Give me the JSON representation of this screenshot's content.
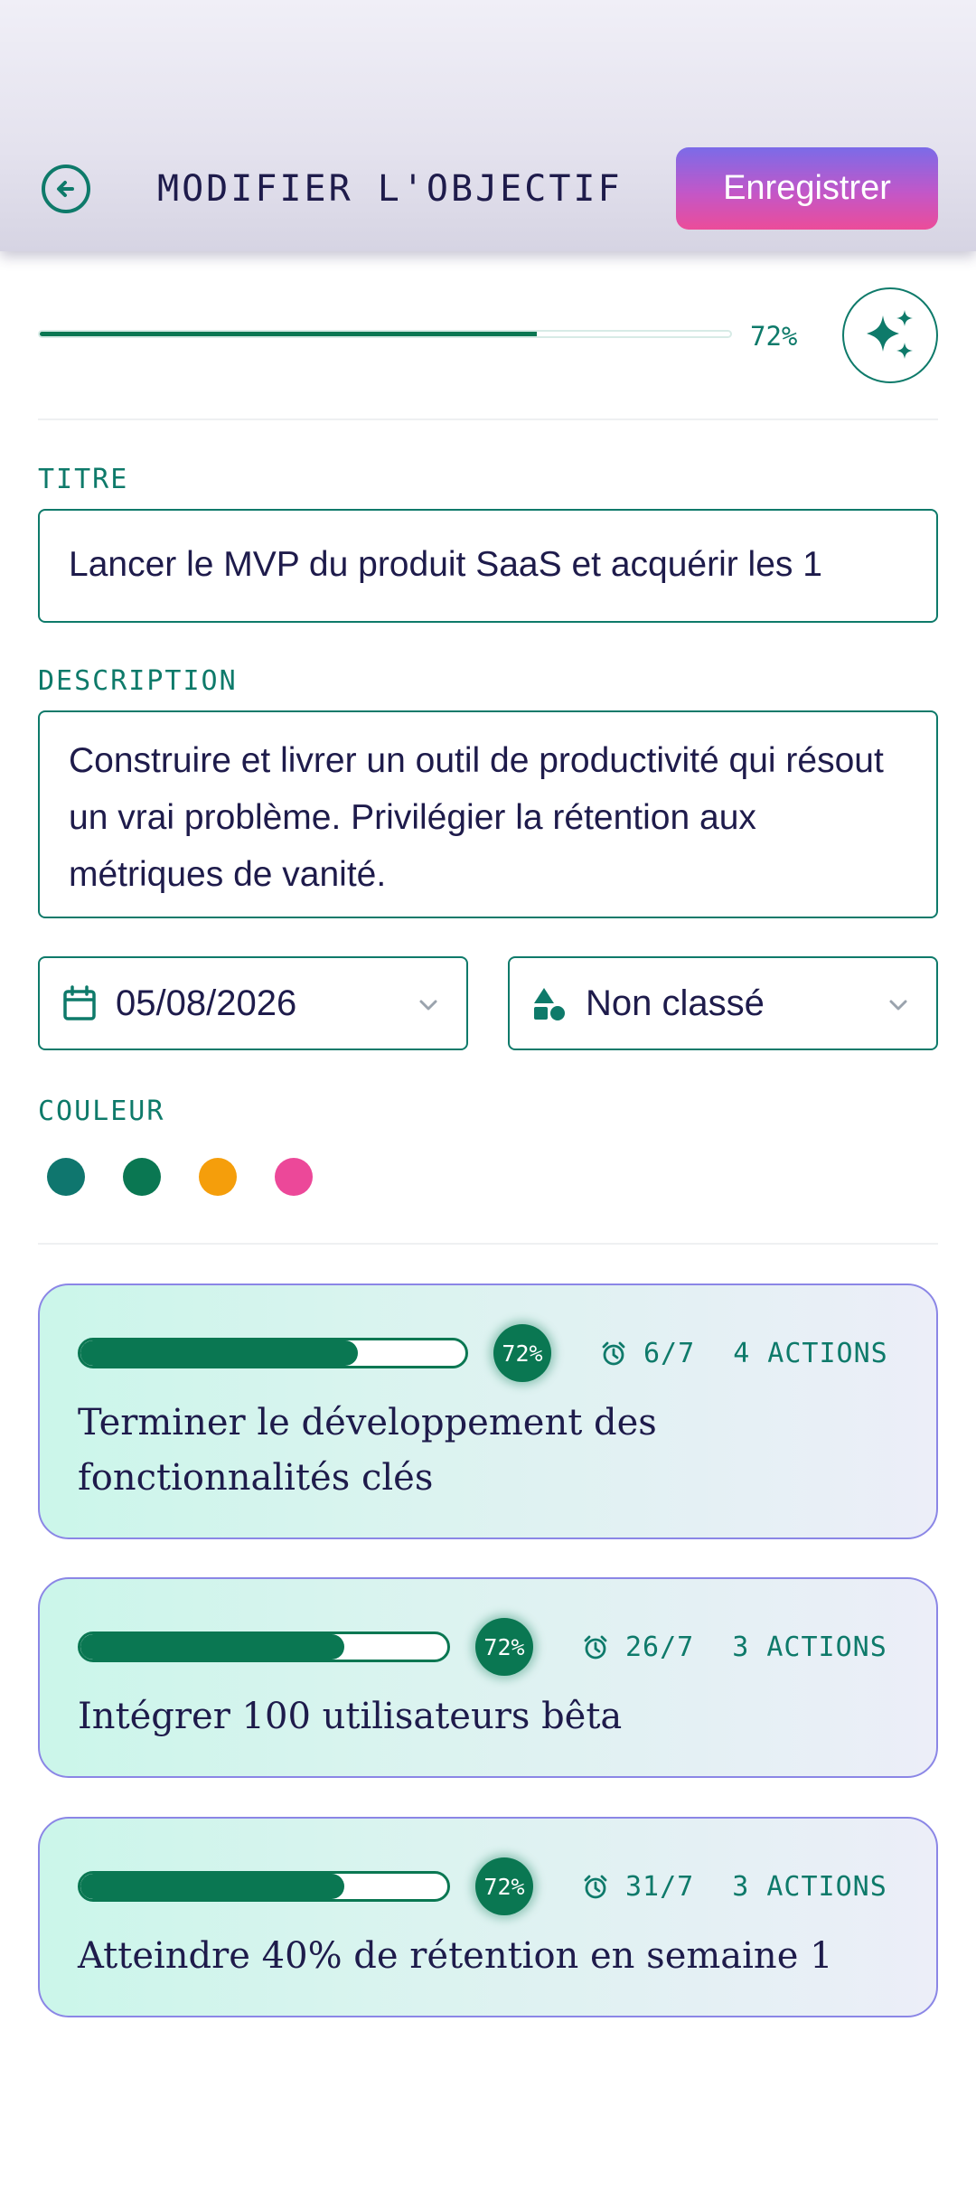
{
  "header": {
    "title": "MODIFIER L'OBJECTIF",
    "save_label": "Enregistrer"
  },
  "progress": {
    "value": 0.72,
    "label": "72%"
  },
  "form": {
    "title_label": "TITRE",
    "title_value": "Lancer le MVP du produit SaaS et acquérir les 1",
    "description_label": "DESCRIPTION",
    "description_value": "Construire et livrer un outil de productivité qui résout un vrai problème. Privilégier la rétention aux métriques de vanité.",
    "date_value": "05/08/2026",
    "category_value": "Non classé",
    "color_label": "COULEUR",
    "colors": [
      "#0f766e",
      "#0a7752",
      "#f59e0b",
      "#ec4899"
    ]
  },
  "milestones": [
    {
      "progress": 0.72,
      "badge": "72%",
      "deadline": "6/7",
      "actions": "4 ACTIONS",
      "title": "Terminer le développement des fonctionnalités clés"
    },
    {
      "progress": 0.72,
      "badge": "72%",
      "deadline": "26/7",
      "actions": "3 ACTIONS",
      "title": "Intégrer 100 utilisateurs bêta"
    },
    {
      "progress": 0.72,
      "badge": "72%",
      "deadline": "31/7",
      "actions": "3 ACTIONS",
      "title": "Atteindre 40% de rétention en semaine 1"
    }
  ],
  "icons": {
    "back": "arrow-left-circle-icon",
    "ai": "sparkles-icon",
    "calendar": "calendar-icon",
    "category": "shapes-icon",
    "chevron": "chevron-down-icon",
    "alarm": "alarm-clock-icon"
  },
  "theme": {
    "accent": "#0e7a6a",
    "progress_green": "#0a7752",
    "card_border": "#8b86e6",
    "text": "#1e1b4b"
  }
}
